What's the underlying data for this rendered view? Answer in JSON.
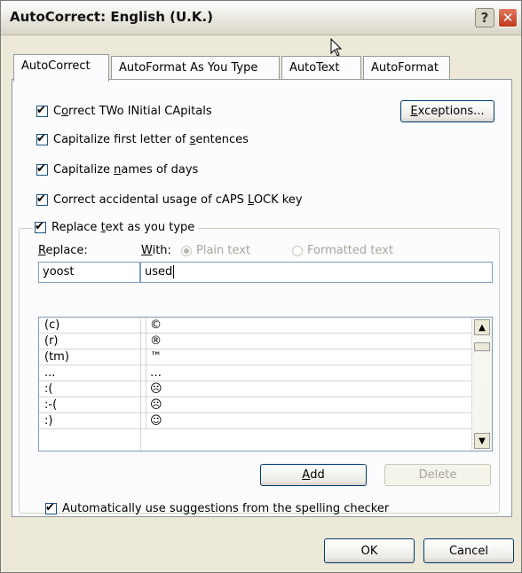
{
  "window": {
    "title": "AutoCorrect: English (U.K.)",
    "help_glyph": "?",
    "close_glyph": "✕"
  },
  "tabs": [
    {
      "label": "AutoCorrect"
    },
    {
      "label": "AutoFormat As You Type"
    },
    {
      "label": "AutoText"
    },
    {
      "label": "AutoFormat"
    }
  ],
  "options": {
    "correct_two_caps": {
      "pre": "C",
      "u": "o",
      "post": "rrect TWo INitial CApitals"
    },
    "capitalize_first": {
      "pre": "Capitalize first letter of ",
      "u": "s",
      "post": "entences"
    },
    "capitalize_days": {
      "pre": "Capitalize ",
      "u": "n",
      "post": "ames of days"
    },
    "caps_lock": {
      "pre": "Correct accidental usage of cAPS ",
      "u": "L",
      "post": "OCK key"
    },
    "replace_text": {
      "pre": "Replace ",
      "u": "t",
      "post": "ext as you type"
    },
    "spelling_suggestions": {
      "pre": "Automatically use su",
      "u": "g",
      "post": "gestions from the spelling checker"
    }
  },
  "exceptions_button": {
    "u": "E",
    "post": "xceptions..."
  },
  "replace_label": {
    "u": "R",
    "post": "eplace:"
  },
  "with_label": {
    "u": "W",
    "post": "ith:"
  },
  "plain_text_label": "Plain text",
  "formatted_text_label": "Formatted text",
  "replace_value": "yoost",
  "with_value": "used",
  "entries": [
    {
      "from": "(c)",
      "to": "©"
    },
    {
      "from": "(r)",
      "to": "®"
    },
    {
      "from": "(tm)",
      "to": "™"
    },
    {
      "from": "...",
      "to": "…"
    },
    {
      "from": ":(",
      "to": "☹"
    },
    {
      "from": ":-(",
      "to": "☹"
    },
    {
      "from": ":)",
      "to": "☺"
    }
  ],
  "add_button": {
    "u": "A",
    "post": "dd"
  },
  "delete_button": "Delete",
  "ok_button": "OK",
  "cancel_button": "Cancel",
  "checkmark": "✔",
  "scroll_up_glyph": "▲",
  "scroll_down_glyph": "▼"
}
